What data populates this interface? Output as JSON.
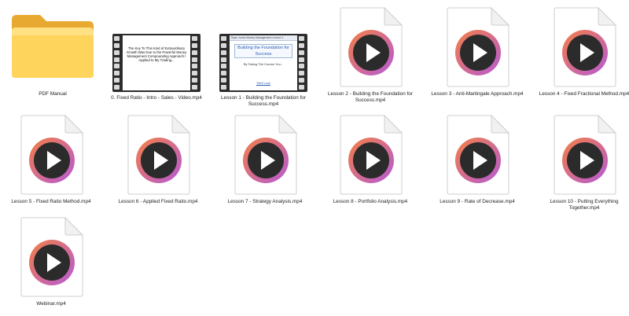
{
  "files": [
    {
      "name": "PDF Manual",
      "kind": "folder"
    },
    {
      "name": "0. Fixed Ratio - Intro - Sales - Video.mp4",
      "kind": "film-intro"
    },
    {
      "name": "Lesson 1 - Building the Foundation for Success.mp4",
      "kind": "film-lesson1"
    },
    {
      "name": "Lesson 2 - Building the Foundation for Success.mp4",
      "kind": "video"
    },
    {
      "name": "Lesson 3 - Anti-Martingale Approach.mp4",
      "kind": "video"
    },
    {
      "name": "Lesson 4 - Fixed Fractional Method.mp4",
      "kind": "video"
    },
    {
      "name": "Lesson 5 - Fixed Ratio Method.mp4",
      "kind": "video"
    },
    {
      "name": "Lesson 6 - Applied Fixed Ratio.mp4",
      "kind": "video"
    },
    {
      "name": "Lesson 7 - Strategy Analysis.mp4",
      "kind": "video"
    },
    {
      "name": "Lesson 8 - Portfolio Analysis.mp4",
      "kind": "video"
    },
    {
      "name": "Lesson 9 - Rate of Decrease.mp4",
      "kind": "video"
    },
    {
      "name": "Lesson 10 - Putting Everything Together.mp4",
      "kind": "video"
    },
    {
      "name": "Webinar.mp4",
      "kind": "video"
    }
  ],
  "thumbnails": {
    "intro_text": "The Key To This Kind of Extraordinary Growth Was Due to the Powerful Money Management Compounding Approach I Applied to My Trading...",
    "lesson1_header": "Ryan Jones Money Management Lesson 1",
    "lesson1_title": "Building the Foundation for Success",
    "lesson1_sub": "By Taking The Course You...",
    "lesson1_link": "TAKE Look"
  },
  "colors": {
    "play_ring_gradient": [
      "#f37f45",
      "#b65ad6"
    ],
    "play_disc": "#2b2b2b",
    "folder_front": "#ffd45c",
    "folder_back": "#e8a930"
  }
}
